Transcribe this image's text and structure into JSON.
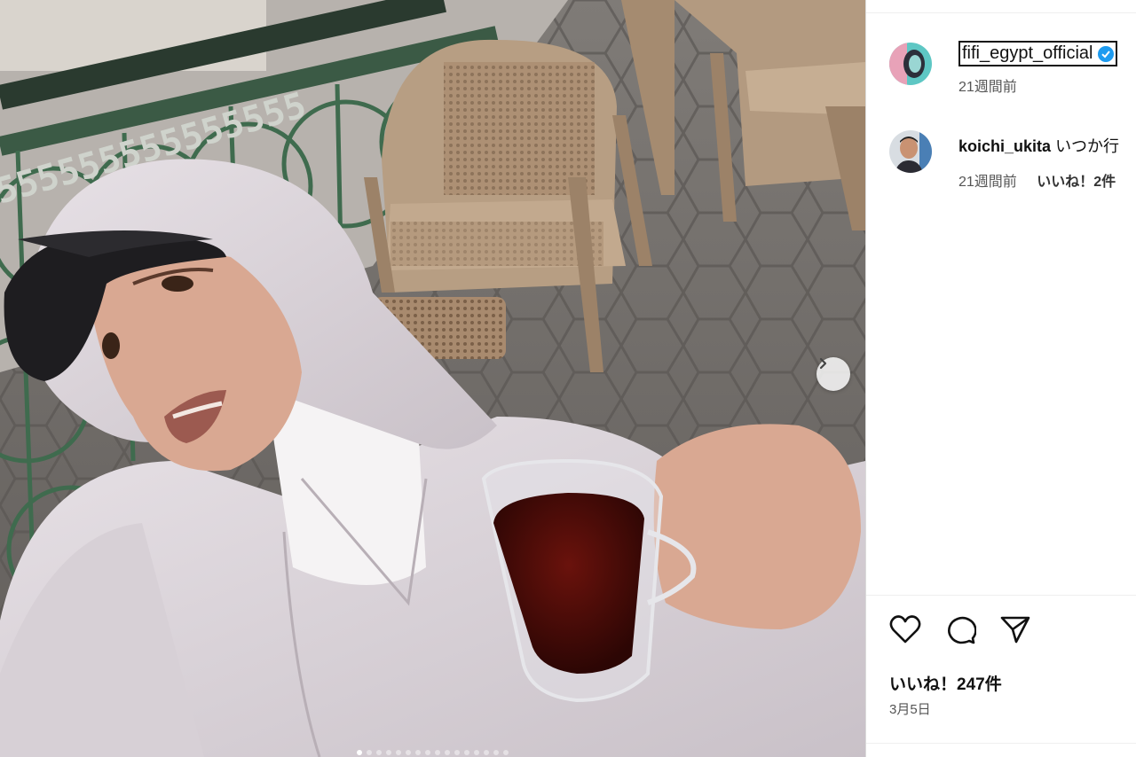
{
  "post": {
    "author": "fifi_egypt_official",
    "posted_ago": "21週間前",
    "likes_text": "いいね！247件",
    "date": "3月5日",
    "carousel": {
      "slide_count": 16,
      "active_index": 0
    }
  },
  "comments": [
    {
      "user": "koichi_ukita",
      "text": "いつか行",
      "posted_ago": "21週間前",
      "likes_text": "いいね！2件"
    }
  ],
  "actions": {
    "like_icon": "heart-icon",
    "comment_icon": "comment-icon",
    "share_icon": "share-icon"
  },
  "colors": {
    "verified_badge": "#1d9bf0"
  }
}
